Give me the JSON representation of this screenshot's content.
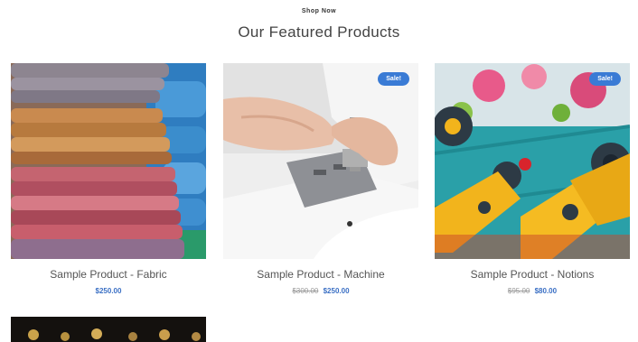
{
  "section": {
    "eyebrow": "Shop Now",
    "title": "Our Featured Products"
  },
  "products": [
    {
      "title": "Sample Product - Fabric",
      "price": "$250.00",
      "compare_price": "",
      "badge": "",
      "image": "stacked-fabric-image"
    },
    {
      "title": "Sample Product - Machine",
      "price": "$250.00",
      "compare_price": "$300.00",
      "badge": "Sale!",
      "image": "sewing-machine-image"
    },
    {
      "title": "Sample Product - Notions",
      "price": "$80.00",
      "compare_price": "$95.00",
      "badge": "Sale!",
      "image": "rotary-cutters-image"
    },
    {
      "title": "",
      "price": "",
      "compare_price": "",
      "badge": "",
      "image": "dark-product-image"
    }
  ],
  "colors": {
    "badge": "#3a7bd5",
    "price": "#3a6fc4",
    "title_text": "#444444"
  }
}
